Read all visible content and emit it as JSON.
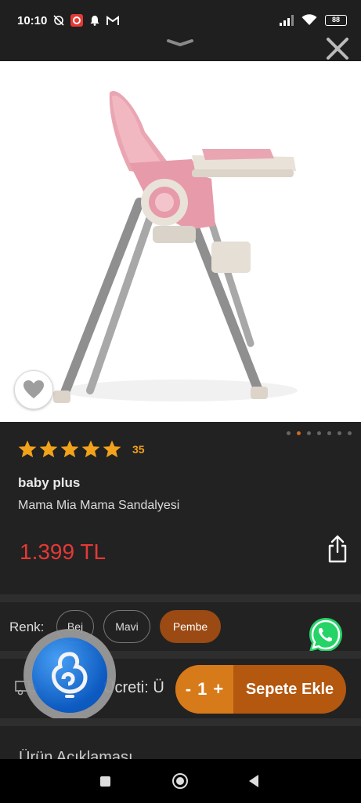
{
  "status_bar": {
    "time": "10:10",
    "battery": "88",
    "icons": [
      "no-alarm-icon",
      "app-notification-icon",
      "bell-icon",
      "gmail-icon",
      "signal-icon",
      "wifi-icon",
      "battery-icon"
    ]
  },
  "product": {
    "rating_stars": 5,
    "rating_count": "35",
    "brand": "baby plus",
    "name": "Mama Mia Mama Sandalyesi",
    "price": "1.399 TL",
    "image_slide_count": 7,
    "image_active_slide": 2
  },
  "color_selector": {
    "label": "Renk:",
    "options": [
      "Bej",
      "Mavi",
      "Pembe"
    ],
    "selected": "Pembe"
  },
  "shipping": {
    "text": "Ücreti: Ü"
  },
  "cart": {
    "minus": "-",
    "quantity": "1",
    "plus": "+",
    "add_label": "Sepete Ekle"
  },
  "description": {
    "title": "Ürün Açıklaması"
  },
  "colors": {
    "accent": "#d77a1a",
    "accent_dark": "#b4570f",
    "price": "#e53935",
    "star": "#f2a21b",
    "background": "#222222"
  }
}
